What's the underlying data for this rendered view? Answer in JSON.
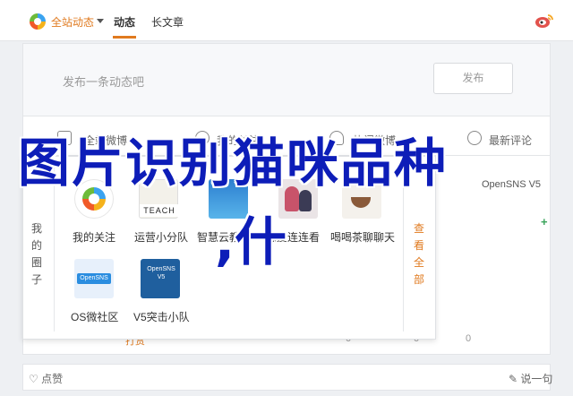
{
  "topbar": {
    "scope_label": "全站动态",
    "tabs": [
      {
        "label": "动态"
      },
      {
        "label": "长文章"
      }
    ]
  },
  "publish": {
    "placeholder": "发布一条动态吧",
    "button_label": "发布"
  },
  "share": {
    "items": [
      {
        "label": "全站微博",
        "icon": "site-weibo-icon"
      },
      {
        "label": "我的关注",
        "icon": "follow-icon"
      },
      {
        "label": "热门微博",
        "icon": "hot-icon"
      },
      {
        "label": "最新评论",
        "icon": "comment-icon"
      }
    ]
  },
  "dropdown": {
    "left_label": "我的圈子",
    "right_label": "查看全部",
    "apps": [
      {
        "label": "我的关注"
      },
      {
        "label": "运营小分队",
        "sign": "TEACH"
      },
      {
        "label": "智慧云教育"
      },
      {
        "label": "恋爱连连看"
      },
      {
        "label": "喝喝茶聊聊天"
      },
      {
        "label": "OS微社区",
        "badge": "OpenSNS"
      },
      {
        "label": "V5突击小队",
        "badge": "OpenSNS V5"
      }
    ]
  },
  "right_card": {
    "partial_text": "OpenSNS V5",
    "plus": "+"
  },
  "stats": {
    "left": "打赏",
    "view": "0",
    "repost": "0",
    "comment": "0"
  },
  "bottom": {
    "like_label": "点赞",
    "say_label": "说一句"
  },
  "overlay": {
    "line1": "图片识别猫咪品种",
    "line2": ",什"
  },
  "colors": {
    "accent": "#e07a1f",
    "headline": "#0d1db8",
    "plus": "#3aa35a"
  }
}
